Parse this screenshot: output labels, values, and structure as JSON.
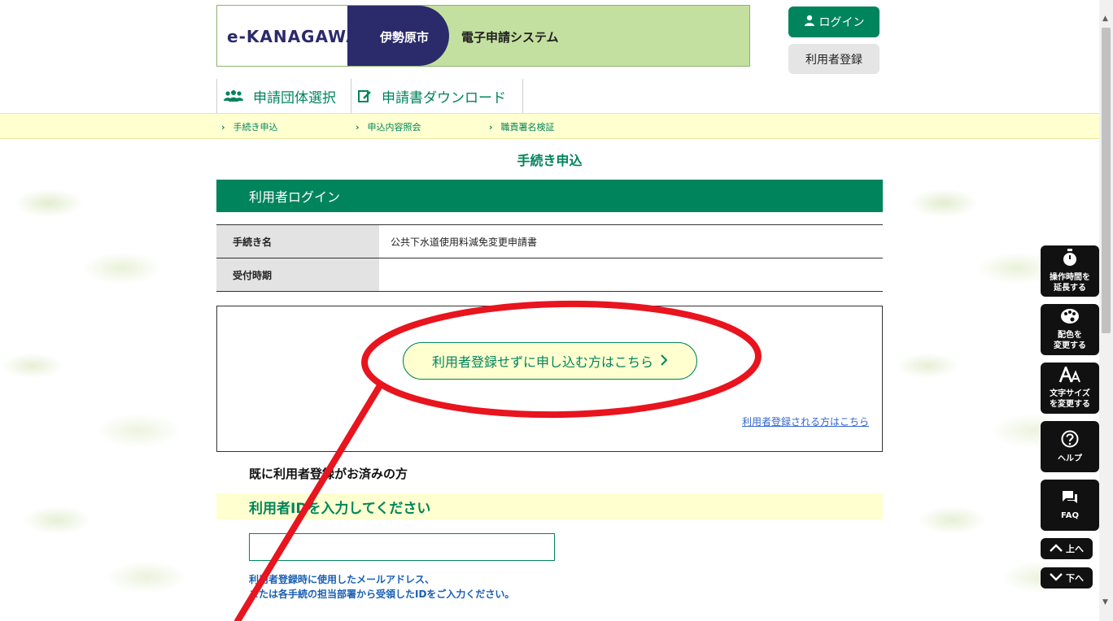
{
  "header": {
    "logo_text": "e-KANAGAWA",
    "city": "伊勢原市",
    "system_name": "電子申請システム"
  },
  "account": {
    "login_label": "ログイン",
    "register_label": "利用者登録"
  },
  "nav": {
    "tabs": [
      {
        "label": "申請団体選択",
        "icon": "people-icon"
      },
      {
        "label": "申請書ダウンロード",
        "icon": "download-form-icon"
      }
    ]
  },
  "subnav": {
    "items": [
      "手続き申込",
      "申込内容照会",
      "職責署名検証"
    ]
  },
  "page": {
    "heading": "手続き申込",
    "section_title": "利用者ログイン"
  },
  "procedure_table": {
    "rows": [
      {
        "label": "手続き名",
        "value": "公共下水道使用料減免変更申請書"
      },
      {
        "label": "受付時期",
        "value": ""
      }
    ]
  },
  "choice": {
    "no_register_button": "利用者登録せずに申し込む方はこちら",
    "register_link": "利用者登録される方はこちら"
  },
  "registered": {
    "heading": "既に利用者登録がお済みの方",
    "id_prompt": "利用者IDを入力してください",
    "id_value": "",
    "help_line1": "利用者登録時に使用したメールアドレス、",
    "help_line2": "または各手続の担当部署から受領したIDをご入力ください。"
  },
  "side_tools": [
    {
      "line1": "操作時間を",
      "line2": "延長する",
      "icon": "stopwatch-icon"
    },
    {
      "line1": "配色を",
      "line2": "変更する",
      "icon": "palette-icon"
    },
    {
      "line1": "文字サイズ",
      "line2": "を変更する",
      "icon": "text-size-icon"
    },
    {
      "line1": "ヘルプ",
      "line2": "",
      "icon": "help-icon"
    },
    {
      "line1": "FAQ",
      "line2": "",
      "icon": "faq-icon"
    }
  ],
  "scroll_buttons": {
    "up": "上へ",
    "down": "下へ"
  },
  "colors": {
    "brand_green": "#00845c",
    "banner_navy": "#2b2a6b",
    "banner_green": "#c4e0a0",
    "highlight_yellow": "#ffffd0",
    "annotation_red": "#e8141e"
  }
}
